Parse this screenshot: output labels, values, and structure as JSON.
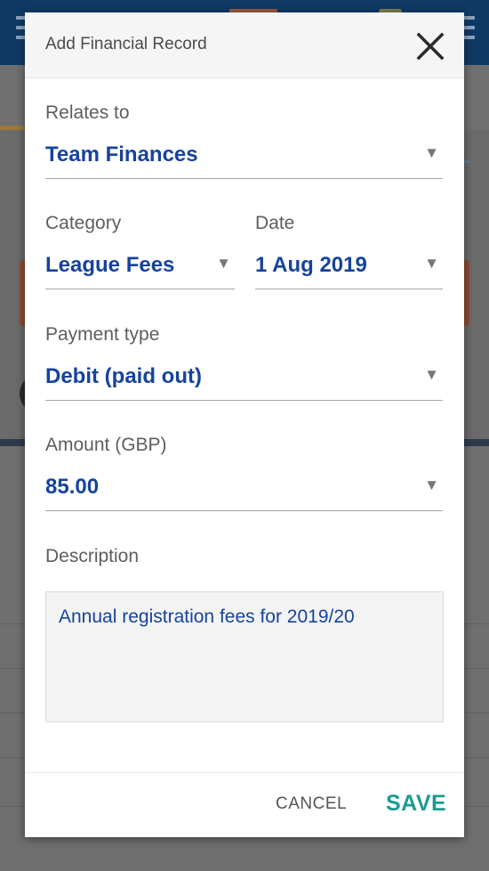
{
  "dialog": {
    "title": "Add Financial Record",
    "close_icon": "close-icon"
  },
  "fields": {
    "relates_to": {
      "label": "Relates to",
      "value": "Team Finances"
    },
    "category": {
      "label": "Category",
      "value": "League Fees"
    },
    "date": {
      "label": "Date",
      "value": "1 Aug 2019"
    },
    "payment_type": {
      "label": "Payment type",
      "value": "Debit (paid out)"
    },
    "amount": {
      "label": "Amount (GBP)",
      "value": "85.00"
    },
    "description": {
      "label": "Description",
      "value": "Annual registration fees for 2019/20"
    }
  },
  "icons": {
    "dropdown": "▼"
  },
  "footer": {
    "cancel_label": "CANCEL",
    "save_label": "SAVE"
  },
  "colors": {
    "accent_value": "#16439c",
    "save": "#1e9a92",
    "app_header": "#0f3a66"
  }
}
